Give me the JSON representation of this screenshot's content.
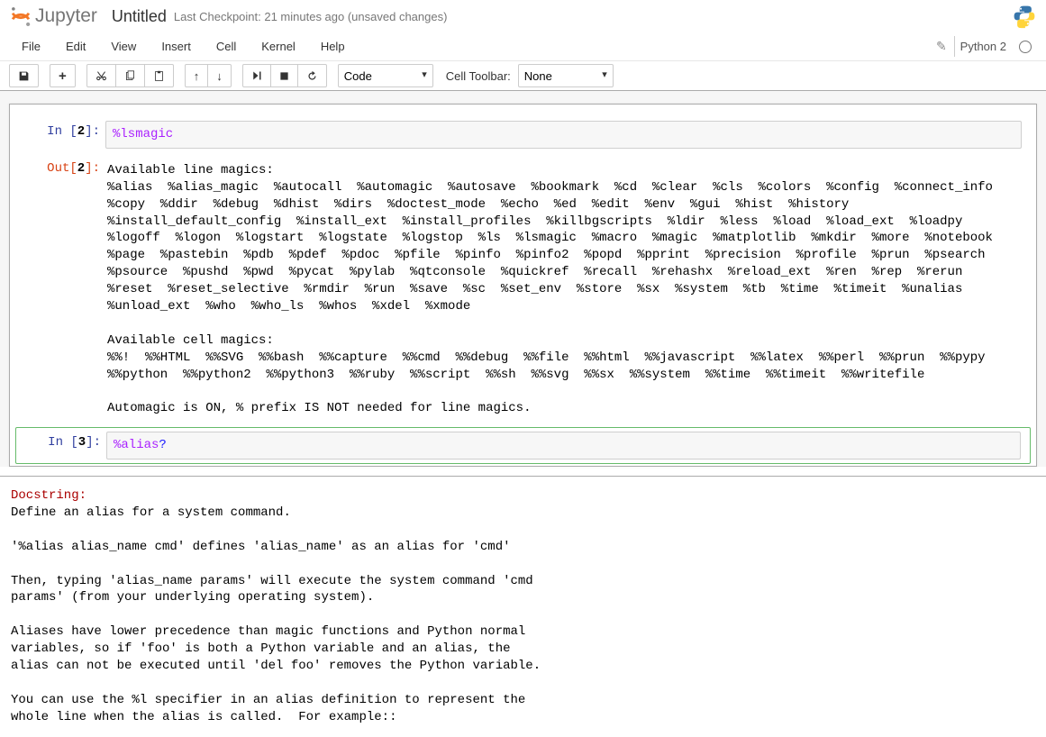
{
  "header": {
    "logo_text": "Jupyter",
    "notebook_name": "Untitled",
    "checkpoint": "Last Checkpoint: 21 minutes ago (unsaved changes)"
  },
  "menubar": {
    "items": [
      "File",
      "Edit",
      "View",
      "Insert",
      "Cell",
      "Kernel",
      "Help"
    ],
    "kernel_name": "Python 2"
  },
  "toolbar": {
    "cell_type": "Code",
    "cell_toolbar_label": "Cell Toolbar:",
    "cell_toolbar": "None"
  },
  "cells": [
    {
      "in_num": "2",
      "input": "%lsmagic",
      "out_num": "2",
      "output": "Available line magics:\n%alias  %alias_magic  %autocall  %automagic  %autosave  %bookmark  %cd  %clear  %cls  %colors  %config  %connect_info  %copy  %ddir  %debug  %dhist  %dirs  %doctest_mode  %echo  %ed  %edit  %env  %gui  %hist  %history  %install_default_config  %install_ext  %install_profiles  %killbgscripts  %ldir  %less  %load  %load_ext  %loadpy  %logoff  %logon  %logstart  %logstate  %logstop  %ls  %lsmagic  %macro  %magic  %matplotlib  %mkdir  %more  %notebook  %page  %pastebin  %pdb  %pdef  %pdoc  %pfile  %pinfo  %pinfo2  %popd  %pprint  %precision  %profile  %prun  %psearch  %psource  %pushd  %pwd  %pycat  %pylab  %qtconsole  %quickref  %recall  %rehashx  %reload_ext  %ren  %rep  %rerun  %reset  %reset_selective  %rmdir  %run  %save  %sc  %set_env  %store  %sx  %system  %tb  %time  %timeit  %unalias  %unload_ext  %who  %who_ls  %whos  %xdel  %xmode\n\nAvailable cell magics:\n%%!  %%HTML  %%SVG  %%bash  %%capture  %%cmd  %%debug  %%file  %%html  %%javascript  %%latex  %%perl  %%prun  %%pypy  %%python  %%python2  %%python3  %%ruby  %%script  %%sh  %%svg  %%sx  %%system  %%time  %%timeit  %%writefile\n\nAutomagic is ON, % prefix IS NOT needed for line magics."
    },
    {
      "in_num": "3",
      "input_magic": "%alias",
      "input_quest": "?"
    }
  ],
  "pager": {
    "heading": "Docstring:",
    "text": "Define an alias for a system command.\n\n'%alias alias_name cmd' defines 'alias_name' as an alias for 'cmd'\n\nThen, typing 'alias_name params' will execute the system command 'cmd\nparams' (from your underlying operating system).\n\nAliases have lower precedence than magic functions and Python normal\nvariables, so if 'foo' is both a Python variable and an alias, the\nalias can not be executed until 'del foo' removes the Python variable.\n\nYou can use the %l specifier in an alias definition to represent the\nwhole line when the alias is called.  For example::"
  }
}
